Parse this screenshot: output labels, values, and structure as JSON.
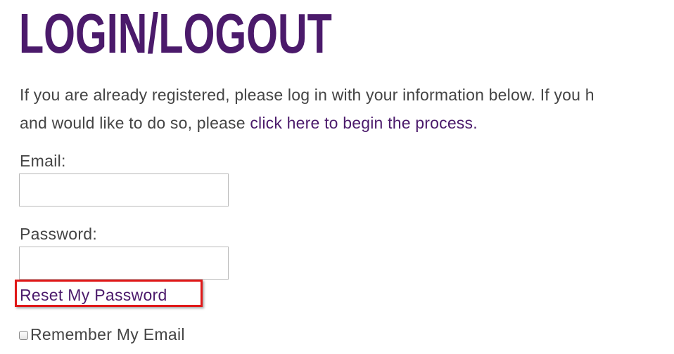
{
  "page": {
    "title": "LOGIN/LOGOUT",
    "intro_line1": "If you are already registered, please log in with your information below. If you h",
    "intro_line2_prefix": "and would like to do so, please ",
    "intro_link": "click here to begin the process."
  },
  "form": {
    "email_label": "Email:",
    "email_value": "",
    "password_label": "Password:",
    "password_value": "",
    "reset_link": "Reset My Password",
    "remember_label": "Remember My Email",
    "remember_checked": false
  },
  "colors": {
    "heading": "#4b1a6b",
    "link": "#4b1a6b",
    "body_text": "#444444",
    "annotation_box": "#e01818"
  }
}
